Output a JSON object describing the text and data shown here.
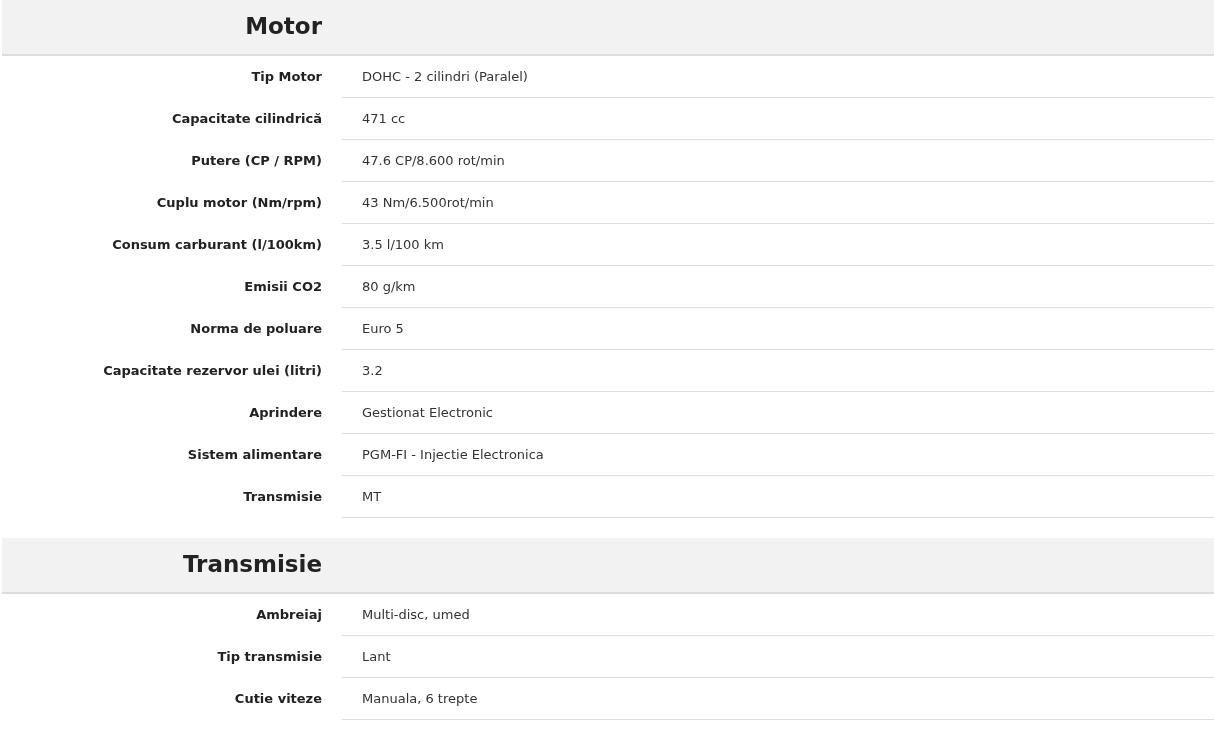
{
  "sections": [
    {
      "title": "Motor",
      "rows": [
        {
          "label": "Tip Motor",
          "value": "DOHC - 2 cilindri (Paralel)"
        },
        {
          "label": "Capacitate cilindrică",
          "value": "471 cc"
        },
        {
          "label": "Putere (CP / RPM)",
          "value": "47.6 CP/8.600 rot/min"
        },
        {
          "label": "Cuplu motor (Nm/rpm)",
          "value": "43 Nm/6.500rot/min"
        },
        {
          "label": "Consum carburant (l/100km)",
          "value": "3.5 l/100 km"
        },
        {
          "label": "Emisii CO2",
          "value": "80 g/km"
        },
        {
          "label": "Norma de poluare",
          "value": "Euro 5"
        },
        {
          "label": "Capacitate rezervor ulei (litri)",
          "value": "3.2"
        },
        {
          "label": "Aprindere",
          "value": "Gestionat Electronic"
        },
        {
          "label": "Sistem alimentare",
          "value": "PGM-FI - Injectie Electronica"
        },
        {
          "label": "Transmisie",
          "value": "MT"
        }
      ]
    },
    {
      "title": "Transmisie",
      "rows": [
        {
          "label": "Ambreiaj",
          "value": "Multi-disc, umed"
        },
        {
          "label": "Tip transmisie",
          "value": "Lant"
        },
        {
          "label": "Cutie viteze",
          "value": "Manuala, 6 trepte"
        }
      ]
    }
  ]
}
